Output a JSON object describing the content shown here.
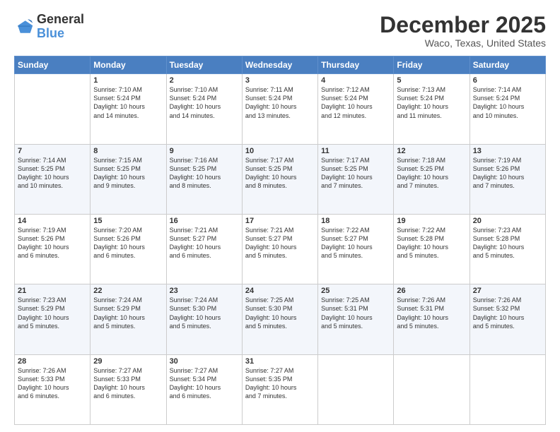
{
  "logo": {
    "line1": "General",
    "line2": "Blue"
  },
  "title": "December 2025",
  "location": "Waco, Texas, United States",
  "weekdays": [
    "Sunday",
    "Monday",
    "Tuesday",
    "Wednesday",
    "Thursday",
    "Friday",
    "Saturday"
  ],
  "weeks": [
    [
      {
        "day": "",
        "info": ""
      },
      {
        "day": "1",
        "info": "Sunrise: 7:10 AM\nSunset: 5:24 PM\nDaylight: 10 hours\nand 14 minutes."
      },
      {
        "day": "2",
        "info": "Sunrise: 7:10 AM\nSunset: 5:24 PM\nDaylight: 10 hours\nand 14 minutes."
      },
      {
        "day": "3",
        "info": "Sunrise: 7:11 AM\nSunset: 5:24 PM\nDaylight: 10 hours\nand 13 minutes."
      },
      {
        "day": "4",
        "info": "Sunrise: 7:12 AM\nSunset: 5:24 PM\nDaylight: 10 hours\nand 12 minutes."
      },
      {
        "day": "5",
        "info": "Sunrise: 7:13 AM\nSunset: 5:24 PM\nDaylight: 10 hours\nand 11 minutes."
      },
      {
        "day": "6",
        "info": "Sunrise: 7:14 AM\nSunset: 5:24 PM\nDaylight: 10 hours\nand 10 minutes."
      }
    ],
    [
      {
        "day": "7",
        "info": "Sunrise: 7:14 AM\nSunset: 5:25 PM\nDaylight: 10 hours\nand 10 minutes."
      },
      {
        "day": "8",
        "info": "Sunrise: 7:15 AM\nSunset: 5:25 PM\nDaylight: 10 hours\nand 9 minutes."
      },
      {
        "day": "9",
        "info": "Sunrise: 7:16 AM\nSunset: 5:25 PM\nDaylight: 10 hours\nand 8 minutes."
      },
      {
        "day": "10",
        "info": "Sunrise: 7:17 AM\nSunset: 5:25 PM\nDaylight: 10 hours\nand 8 minutes."
      },
      {
        "day": "11",
        "info": "Sunrise: 7:17 AM\nSunset: 5:25 PM\nDaylight: 10 hours\nand 7 minutes."
      },
      {
        "day": "12",
        "info": "Sunrise: 7:18 AM\nSunset: 5:25 PM\nDaylight: 10 hours\nand 7 minutes."
      },
      {
        "day": "13",
        "info": "Sunrise: 7:19 AM\nSunset: 5:26 PM\nDaylight: 10 hours\nand 7 minutes."
      }
    ],
    [
      {
        "day": "14",
        "info": "Sunrise: 7:19 AM\nSunset: 5:26 PM\nDaylight: 10 hours\nand 6 minutes."
      },
      {
        "day": "15",
        "info": "Sunrise: 7:20 AM\nSunset: 5:26 PM\nDaylight: 10 hours\nand 6 minutes."
      },
      {
        "day": "16",
        "info": "Sunrise: 7:21 AM\nSunset: 5:27 PM\nDaylight: 10 hours\nand 6 minutes."
      },
      {
        "day": "17",
        "info": "Sunrise: 7:21 AM\nSunset: 5:27 PM\nDaylight: 10 hours\nand 5 minutes."
      },
      {
        "day": "18",
        "info": "Sunrise: 7:22 AM\nSunset: 5:27 PM\nDaylight: 10 hours\nand 5 minutes."
      },
      {
        "day": "19",
        "info": "Sunrise: 7:22 AM\nSunset: 5:28 PM\nDaylight: 10 hours\nand 5 minutes."
      },
      {
        "day": "20",
        "info": "Sunrise: 7:23 AM\nSunset: 5:28 PM\nDaylight: 10 hours\nand 5 minutes."
      }
    ],
    [
      {
        "day": "21",
        "info": "Sunrise: 7:23 AM\nSunset: 5:29 PM\nDaylight: 10 hours\nand 5 minutes."
      },
      {
        "day": "22",
        "info": "Sunrise: 7:24 AM\nSunset: 5:29 PM\nDaylight: 10 hours\nand 5 minutes."
      },
      {
        "day": "23",
        "info": "Sunrise: 7:24 AM\nSunset: 5:30 PM\nDaylight: 10 hours\nand 5 minutes."
      },
      {
        "day": "24",
        "info": "Sunrise: 7:25 AM\nSunset: 5:30 PM\nDaylight: 10 hours\nand 5 minutes."
      },
      {
        "day": "25",
        "info": "Sunrise: 7:25 AM\nSunset: 5:31 PM\nDaylight: 10 hours\nand 5 minutes."
      },
      {
        "day": "26",
        "info": "Sunrise: 7:26 AM\nSunset: 5:31 PM\nDaylight: 10 hours\nand 5 minutes."
      },
      {
        "day": "27",
        "info": "Sunrise: 7:26 AM\nSunset: 5:32 PM\nDaylight: 10 hours\nand 5 minutes."
      }
    ],
    [
      {
        "day": "28",
        "info": "Sunrise: 7:26 AM\nSunset: 5:33 PM\nDaylight: 10 hours\nand 6 minutes."
      },
      {
        "day": "29",
        "info": "Sunrise: 7:27 AM\nSunset: 5:33 PM\nDaylight: 10 hours\nand 6 minutes."
      },
      {
        "day": "30",
        "info": "Sunrise: 7:27 AM\nSunset: 5:34 PM\nDaylight: 10 hours\nand 6 minutes."
      },
      {
        "day": "31",
        "info": "Sunrise: 7:27 AM\nSunset: 5:35 PM\nDaylight: 10 hours\nand 7 minutes."
      },
      {
        "day": "",
        "info": ""
      },
      {
        "day": "",
        "info": ""
      },
      {
        "day": "",
        "info": ""
      }
    ]
  ]
}
